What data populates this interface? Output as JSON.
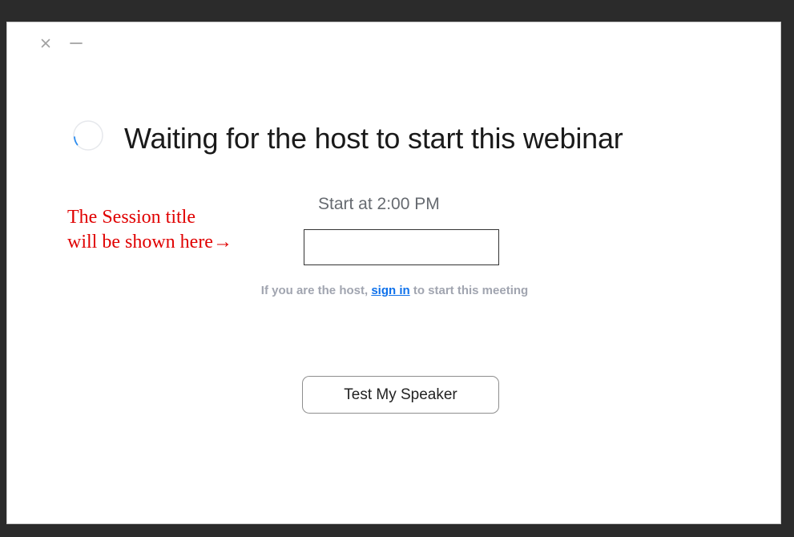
{
  "window": {
    "controls": {
      "close_icon": "close-icon",
      "minimize_icon": "minimize-icon"
    }
  },
  "status": {
    "heading": "Waiting for the host to start this webinar",
    "start_time": "Start at 2:00 PM",
    "spinner_icon": "loading-spinner-icon"
  },
  "annotation": {
    "line1": "The Session title",
    "line2": "will be shown here→"
  },
  "session_title": {
    "value": ""
  },
  "host_prompt": {
    "prefix": "If you are the host,",
    "link_label": "sign in",
    "suffix": "to start this meeting"
  },
  "actions": {
    "test_speaker_label": "Test My Speaker"
  },
  "colors": {
    "link": "#0e71eb",
    "annotation": "#e00000",
    "heading": "#1a1a1a",
    "muted_text": "#a1a5b0"
  }
}
